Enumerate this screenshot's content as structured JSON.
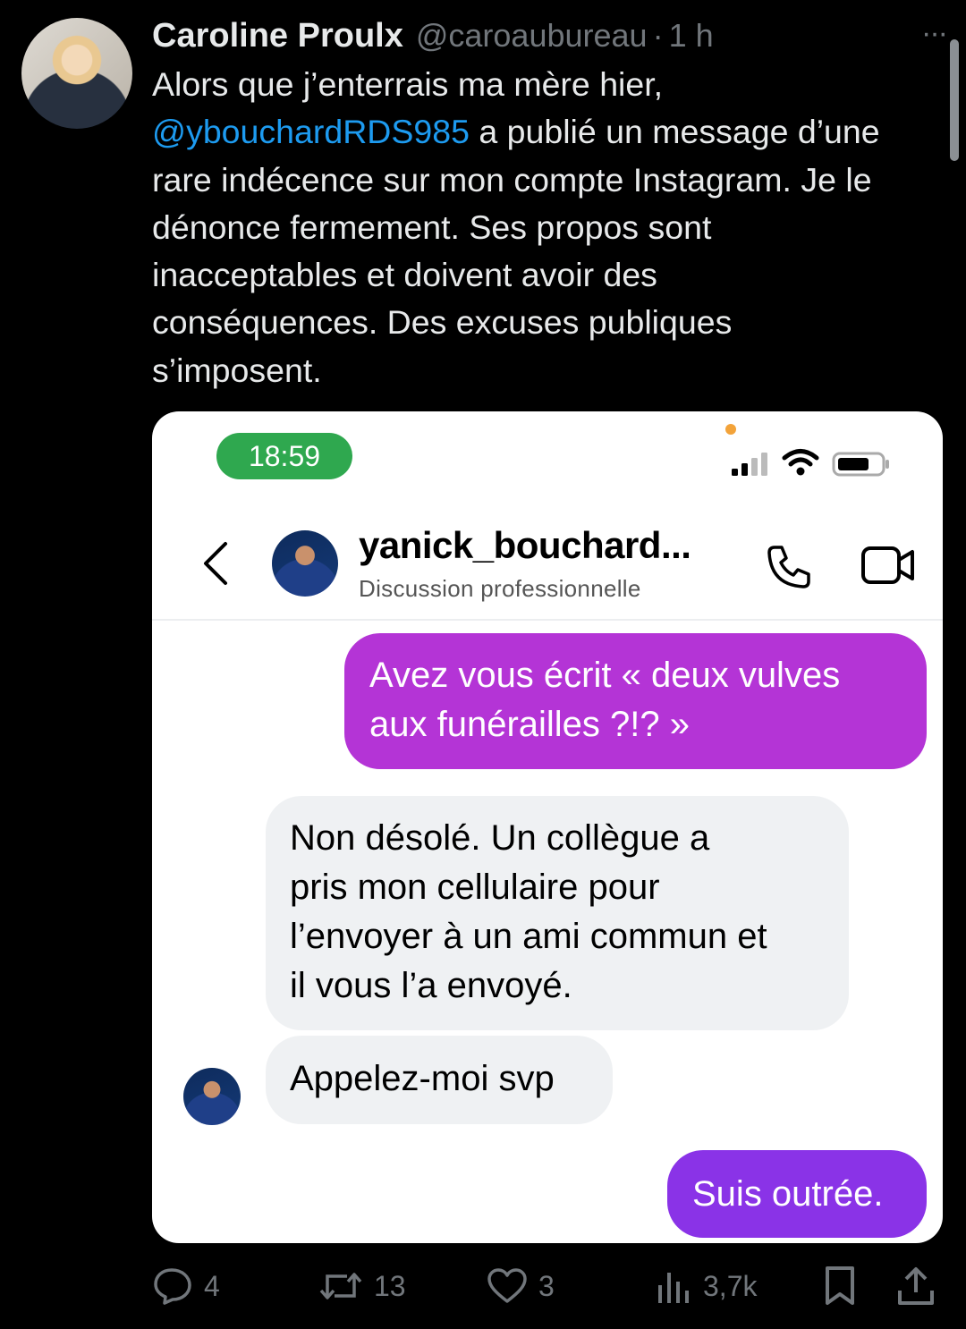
{
  "tweet": {
    "author_name": "Caroline Proulx",
    "handle": "@caroaubureau",
    "separator": "·",
    "time": "1 h",
    "more_glyph": "···",
    "text_line1": "Alors que j’enterrais ma mère hier,",
    "mention": "@ybouchardRDS985",
    "text_rest": " a publié un message d’une\nrare indécence sur mon compte Instagram. Je le\ndénonce fermement. Ses propos sont\ninacceptables et doivent avoir des\nconséquences. Des excuses publiques\ns’imposent."
  },
  "screenshot": {
    "status_time": "18:59",
    "contact_name": "yanick_bouchard...",
    "contact_subtitle": "Discussion professionnelle",
    "messages": [
      {
        "sender": "me",
        "text": "Avez vous écrit « deux vulves\naux funérailles ?!? »"
      },
      {
        "sender": "contact",
        "text": "Non désolé. Un collègue a\npris mon cellulaire pour\nl’envoyer à un ami commun et\nil vous l’a envoyé."
      },
      {
        "sender": "contact",
        "text": "Appelez-moi svp"
      },
      {
        "sender": "me",
        "text": "Suis outrée."
      }
    ],
    "colors": {
      "sent_bubble_1": "#b434d6",
      "sent_bubble_2": "#8a33e7",
      "received_bubble": "#eff1f3",
      "status_pill": "#2fa84f"
    }
  },
  "actions": {
    "replies": "4",
    "reposts": "13",
    "likes": "3",
    "views": "3,7k"
  },
  "icons": [
    "reply-icon",
    "repost-icon",
    "like-icon",
    "views-icon",
    "bookmark-icon",
    "share-icon",
    "phone-icon",
    "video-icon",
    "back-icon"
  ]
}
